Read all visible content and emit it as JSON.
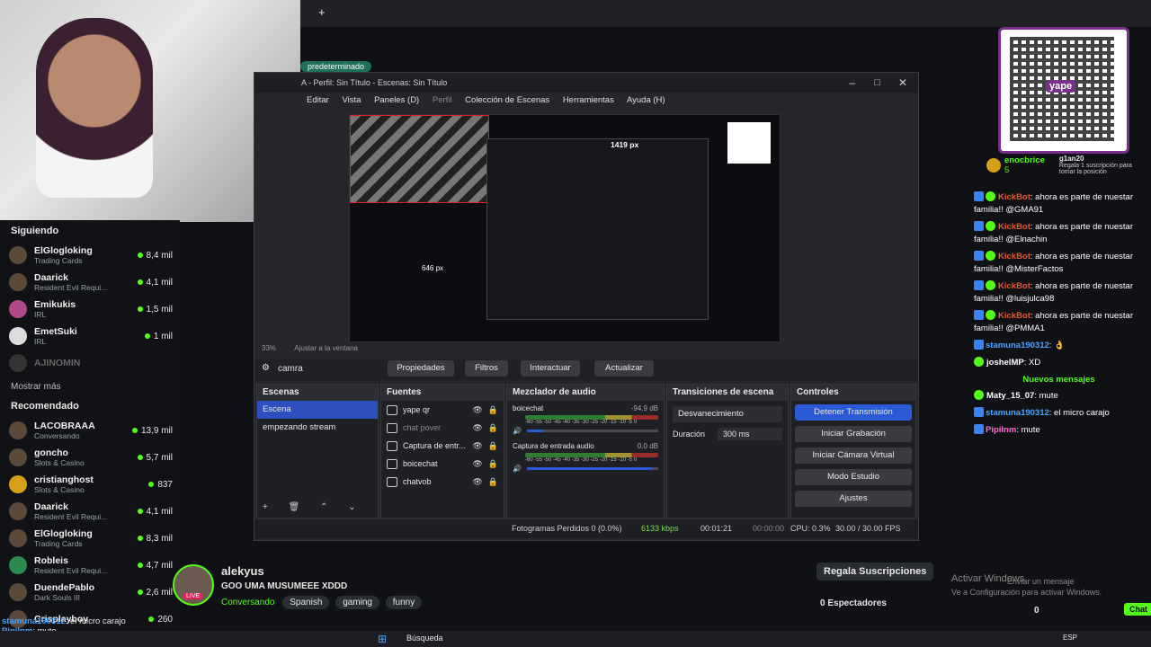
{
  "webcam": {
    "label": "webcam overlay"
  },
  "browser": {
    "new_tab": "+",
    "tab_label": "predeterminado"
  },
  "sidebar": {
    "following_title": "Siguiendo",
    "following": [
      {
        "name": "ElGlogloking",
        "category": "Trading Cards",
        "viewers": "8,4 mil"
      },
      {
        "name": "Daarick",
        "category": "Resident Evil Requi...",
        "viewers": "4,1 mil"
      },
      {
        "name": "Emikukis",
        "category": "IRL",
        "viewers": "1,5 mil"
      },
      {
        "name": "EmetSuki",
        "category": "IRL",
        "viewers": "1 mil"
      },
      {
        "name": "AJINOMIN",
        "category": "",
        "viewers": ""
      }
    ],
    "show_more": "Mostrar más",
    "recommended_title": "Recomendado",
    "recommended": [
      {
        "name": "LACOBRAAA",
        "category": "Conversando",
        "viewers": "13,9 mil"
      },
      {
        "name": "goncho",
        "category": "Slots & Casino",
        "viewers": "5,7 mil"
      },
      {
        "name": "cristianghost",
        "category": "Slots & Casino",
        "viewers": "837"
      },
      {
        "name": "Daarick",
        "category": "Resident Evil Requi...",
        "viewers": "4,1 mil"
      },
      {
        "name": "ElGlogloking",
        "category": "Trading Cards",
        "viewers": "8,3 mil"
      },
      {
        "name": "Robleis",
        "category": "Resident Evil Requi...",
        "viewers": "4,7 mil"
      },
      {
        "name": "DuendePablo",
        "category": "Dark Souls III",
        "viewers": "2,6 mil"
      },
      {
        "name": "Crisplayboy",
        "category": "",
        "viewers": "260"
      }
    ]
  },
  "obs": {
    "title": "A - Perfil: Sin Título - Escenas: Sin Título",
    "menu": [
      "Editar",
      "Vista",
      "Paneles (D)",
      "Perfil",
      "Colección de Escenas",
      "Herramientas",
      "Ayuda (H)"
    ],
    "preview_dims": "1419 px",
    "preview_dims2": "646 px",
    "zoom": "33%",
    "fit": "Ajustar a la ventana",
    "source_name": "camra",
    "toolbar": [
      "Propiedades",
      "Filtros",
      "Interactuar",
      "Actualizar"
    ],
    "scenes_title": "Escenas",
    "scenes": [
      "Escena",
      "empezando stream"
    ],
    "sources_title": "Fuentes",
    "sources": [
      "yape qr",
      "chat pover",
      "Captura de entr...",
      "boicechat",
      "chatvob"
    ],
    "mixer_title": "Mezclador de audio",
    "mixer": [
      {
        "name": "boicechat",
        "db": "-94.9 dB",
        "level": 0.12
      },
      {
        "name": "Captura de entrada audio",
        "db": "0.0 dB",
        "level": 0.95
      }
    ],
    "mixer_scale": "-60 -55 -50 -45 -40 -35 -30 -25 -20 -15 -10 -5 0",
    "transitions_title": "Transiciones de escena",
    "transition": "Desvanecimiento",
    "duration_label": "Duración",
    "duration": "300 ms",
    "controls_title": "Controles",
    "controls": [
      "Detener Transmisión",
      "Iniciar Grabación",
      "Iniciar Cámara Virtual",
      "Modo Estudio",
      "Ajustes"
    ],
    "status": {
      "frames": "Fotogramas Perdidos 0 (0.0%)",
      "kbps": "6133 kbps",
      "time1": "00:01:21",
      "time2": "00:00:00",
      "cpu": "CPU: 0.3%",
      "fps": "30.00 / 30.00 FPS"
    }
  },
  "qr": {
    "brand": "yape"
  },
  "chat": {
    "pinned_user": "enocbrice",
    "pinned_count": "5",
    "gift_user": "g1an20",
    "gift_text": "Regala 1 suscripción para tomar la posición",
    "messages": [
      {
        "user": "KickBot",
        "text": ": ahora es parte de nuestar familia!! @GMA91"
      },
      {
        "user": "KickBot",
        "text": ": ahora es parte de nuestar familia!! @Elnachin"
      },
      {
        "user": "KickBot",
        "text": ": ahora es parte de nuestar familia!! @MisterFactos"
      },
      {
        "user": "KickBot",
        "text": ": ahora es parte de nuestar familia!! @luisjulca98"
      },
      {
        "user": "KickBot",
        "text": ": ahora es parte de nuestar familia!! @PMMA1"
      },
      {
        "user": "stamuna190312",
        "text": ":"
      },
      {
        "user": "joshelMP",
        "text": ": XD"
      }
    ],
    "new_messages": "Nuevos mensajes",
    "new": [
      {
        "user": "Maty_15_07",
        "text": ": mute"
      },
      {
        "user": "stamuna190312",
        "text": ": el micro carajo"
      },
      {
        "user": "Pipilnm",
        "text": ": mute"
      }
    ],
    "input_placeholder": "Enviar un mensaje",
    "chat_btn": "Chat"
  },
  "stream": {
    "streamer": "alekyus",
    "title": "GOO UMA MUSUMEEE XDDD",
    "live": "LIVE",
    "category": "Conversando",
    "tags": [
      "Spanish",
      "gaming",
      "funny"
    ],
    "gift_button": "Regala Suscripciones",
    "viewers": "0 Espectadores",
    "activate1": "Activar Windows",
    "activate2": "Ve a Configuración para activar Windows."
  },
  "overlay_chat": [
    {
      "user": "stamuna190312",
      "text": ": el micro carajo"
    },
    {
      "user": "Pipilnm",
      "text": ": mute"
    }
  ],
  "bottom_right": {
    "count": "0"
  },
  "taskbar": {
    "search": "Búsqueda",
    "lang": "ESP"
  }
}
